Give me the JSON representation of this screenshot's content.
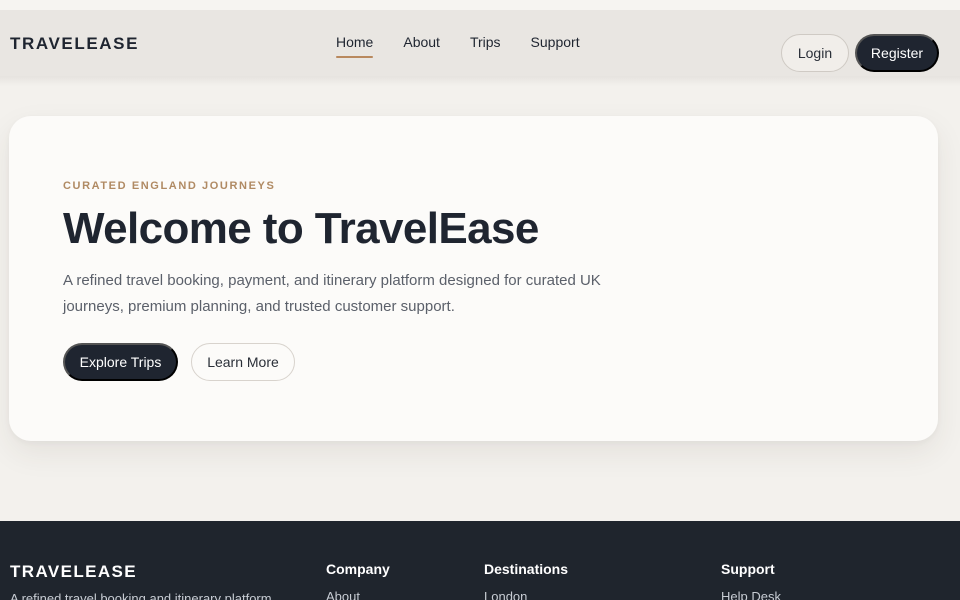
{
  "nav": {
    "brand": "TRAVELEASE",
    "links": [
      "Home",
      "About",
      "Trips",
      "Support"
    ],
    "active": "Home",
    "login": "Login",
    "register": "Register"
  },
  "hero": {
    "eyebrow": "CURATED ENGLAND JOURNEYS",
    "title": "Welcome to TravelEase",
    "description": "A refined travel booking, payment, and itinerary platform designed for curated UK journeys, premium planning, and trusted customer support.",
    "primary_cta": "Explore Trips",
    "secondary_cta": "Learn More"
  },
  "footer": {
    "brand": "TRAVELEASE",
    "tagline": "A refined travel booking and itinerary platform",
    "columns": [
      {
        "title": "Company",
        "first_item": "About"
      },
      {
        "title": "Destinations",
        "first_item": "London"
      },
      {
        "title": "Support",
        "first_item": "Help Desk"
      }
    ]
  },
  "colors": {
    "accent": "#b9895e",
    "dark": "#1f2530",
    "background": "#f3f1ed"
  }
}
